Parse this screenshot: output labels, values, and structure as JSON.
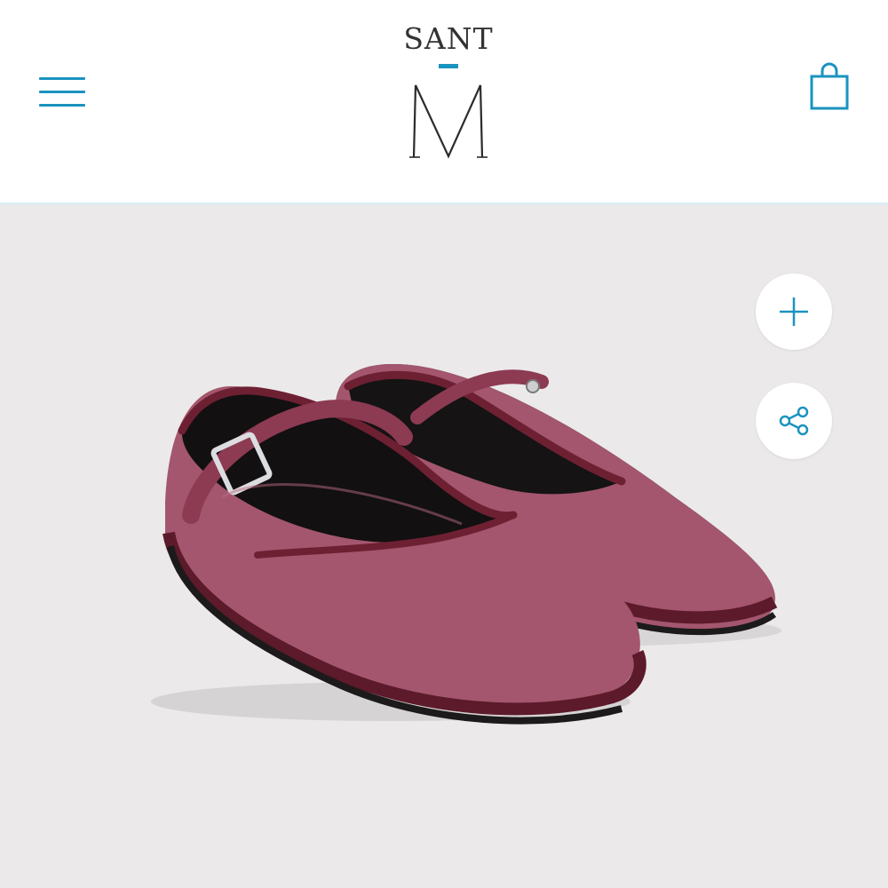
{
  "brand": {
    "top_text": "SANT",
    "mark_letter": "M"
  },
  "header": {
    "menu_icon": "hamburger-icon",
    "cart_icon": "shopping-bag-icon"
  },
  "product": {
    "image_icon": "product-photo-velvet-mary-jane-flats",
    "colors": {
      "velvet": "#a3566e",
      "trim": "#6e2033",
      "background": "#ebe9ea"
    }
  },
  "actions": {
    "add_icon": "plus-icon",
    "share_icon": "share-icon"
  },
  "theme": {
    "accent": "#1b93bf",
    "divider": "#d6eef4"
  }
}
